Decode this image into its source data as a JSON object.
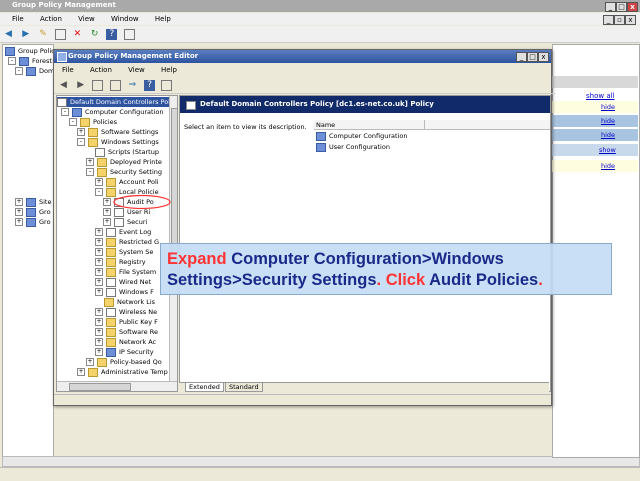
{
  "outer": {
    "title": "Group Policy Management",
    "menu": [
      "File",
      "Action",
      "View",
      "Window",
      "Help"
    ],
    "tree": [
      "Group Policy",
      "Forest:",
      "Dom",
      "Site",
      "Gro",
      "Gro"
    ],
    "links": [
      "show all",
      "hide",
      "hide",
      "hide",
      "show",
      "hide"
    ]
  },
  "editor": {
    "title": "Group Policy Management Editor",
    "menu": [
      "File",
      "Action",
      "View",
      "Help"
    ],
    "tree_root": "Default Domain Controllers Polic",
    "tree": [
      "Computer Configuration",
      "Policies",
      "Software Settings",
      "Windows Settings",
      "Scripts (Startup",
      "Deployed Printe",
      "Security Setting",
      "Account Poli",
      "Local Policie",
      "Audit Po",
      "User Ri",
      "Securi",
      "Event Log",
      "Restricted G",
      "System Se",
      "Registry",
      "File System",
      "Wired Net",
      "Windows F",
      "Network Lis",
      "Wireless Ne",
      "Public Key F",
      "Software Re",
      "Network Ac",
      "IP Security",
      "Policy-based Qo",
      "Administrative Temp"
    ],
    "header": "Default Domain Controllers Policy [dc1.es-net.co.uk] Policy",
    "description": "Select an item to view its description.",
    "column_name": "Name",
    "items": [
      "Computer Configuration",
      "User Configuration"
    ],
    "tabs": [
      "Extended",
      "Standard"
    ]
  },
  "callout": {
    "w1": "Expand",
    "w2": "Computer Configuration>Windows Settings>Security Settings",
    "w3": ".",
    "w4": "Click",
    "w5": "Audit Policies",
    "w6": ".",
    "accent_color": "#ff3333",
    "text_color": "#1a2a8a"
  }
}
